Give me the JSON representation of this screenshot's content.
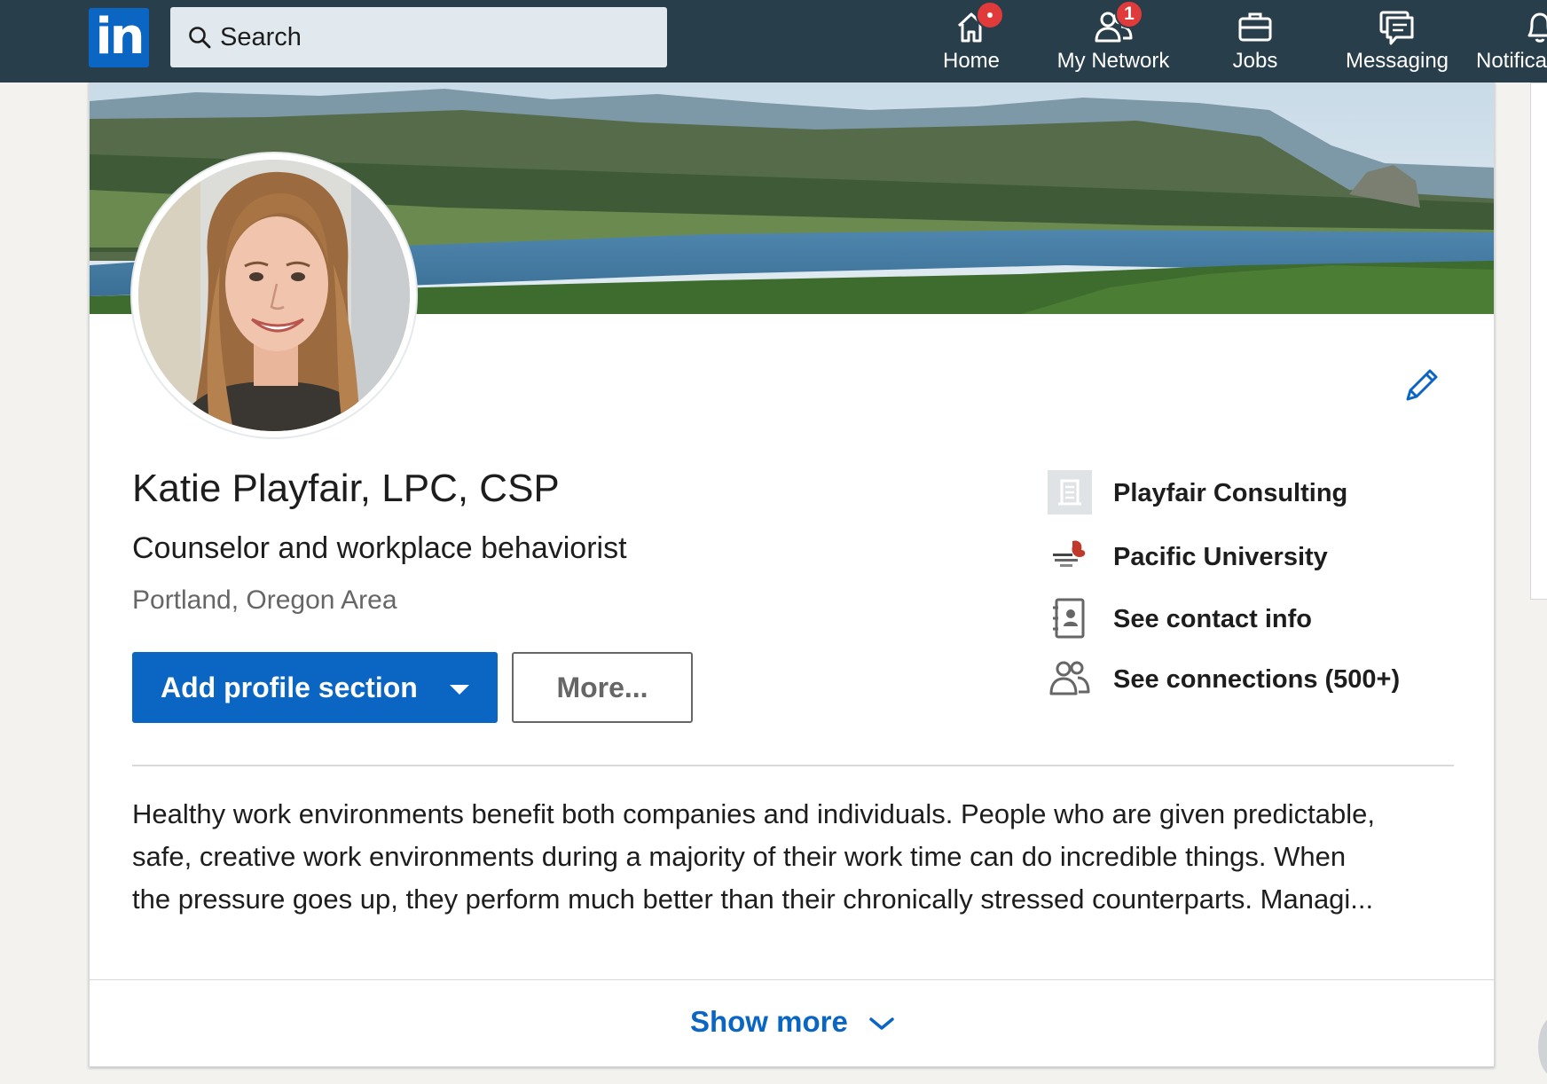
{
  "nav": {
    "search_placeholder": "Search",
    "items": [
      {
        "label": "Home",
        "icon": "home-icon",
        "badge": ""
      },
      {
        "label": "My Network",
        "icon": "people-icon",
        "badge": "1"
      },
      {
        "label": "Jobs",
        "icon": "briefcase-icon",
        "badge": ""
      },
      {
        "label": "Messaging",
        "icon": "messaging-icon",
        "badge": ""
      },
      {
        "label": "Notifica",
        "icon": "bell-icon",
        "badge": ""
      }
    ]
  },
  "profile": {
    "name": "Katie Playfair, LPC, CSP",
    "headline": "Counselor and workplace behaviorist",
    "location": "Portland, Oregon Area",
    "add_section_label": "Add profile section",
    "more_label": "More...",
    "side_items": [
      {
        "label": "Playfair Consulting",
        "icon": "company-icon"
      },
      {
        "label": "Pacific University",
        "icon": "school-logo-icon"
      },
      {
        "label": "See contact info",
        "icon": "contact-card-icon"
      },
      {
        "label": "See connections (500+)",
        "icon": "connections-icon"
      }
    ],
    "summary_lines": [
      "Healthy work environments benefit both companies and individuals. People who are given predictable,",
      "safe, creative work environments during a majority of their work time can do incredible things. When",
      "the pressure goes up, they perform much better than their chronically stressed counterparts. Managi..."
    ],
    "show_more_label": "Show more"
  },
  "colors": {
    "nav_bg": "#283e4a",
    "brand_blue": "#0a66c2",
    "badge_red": "#e03a3a",
    "page_bg": "#f3f2ef"
  }
}
